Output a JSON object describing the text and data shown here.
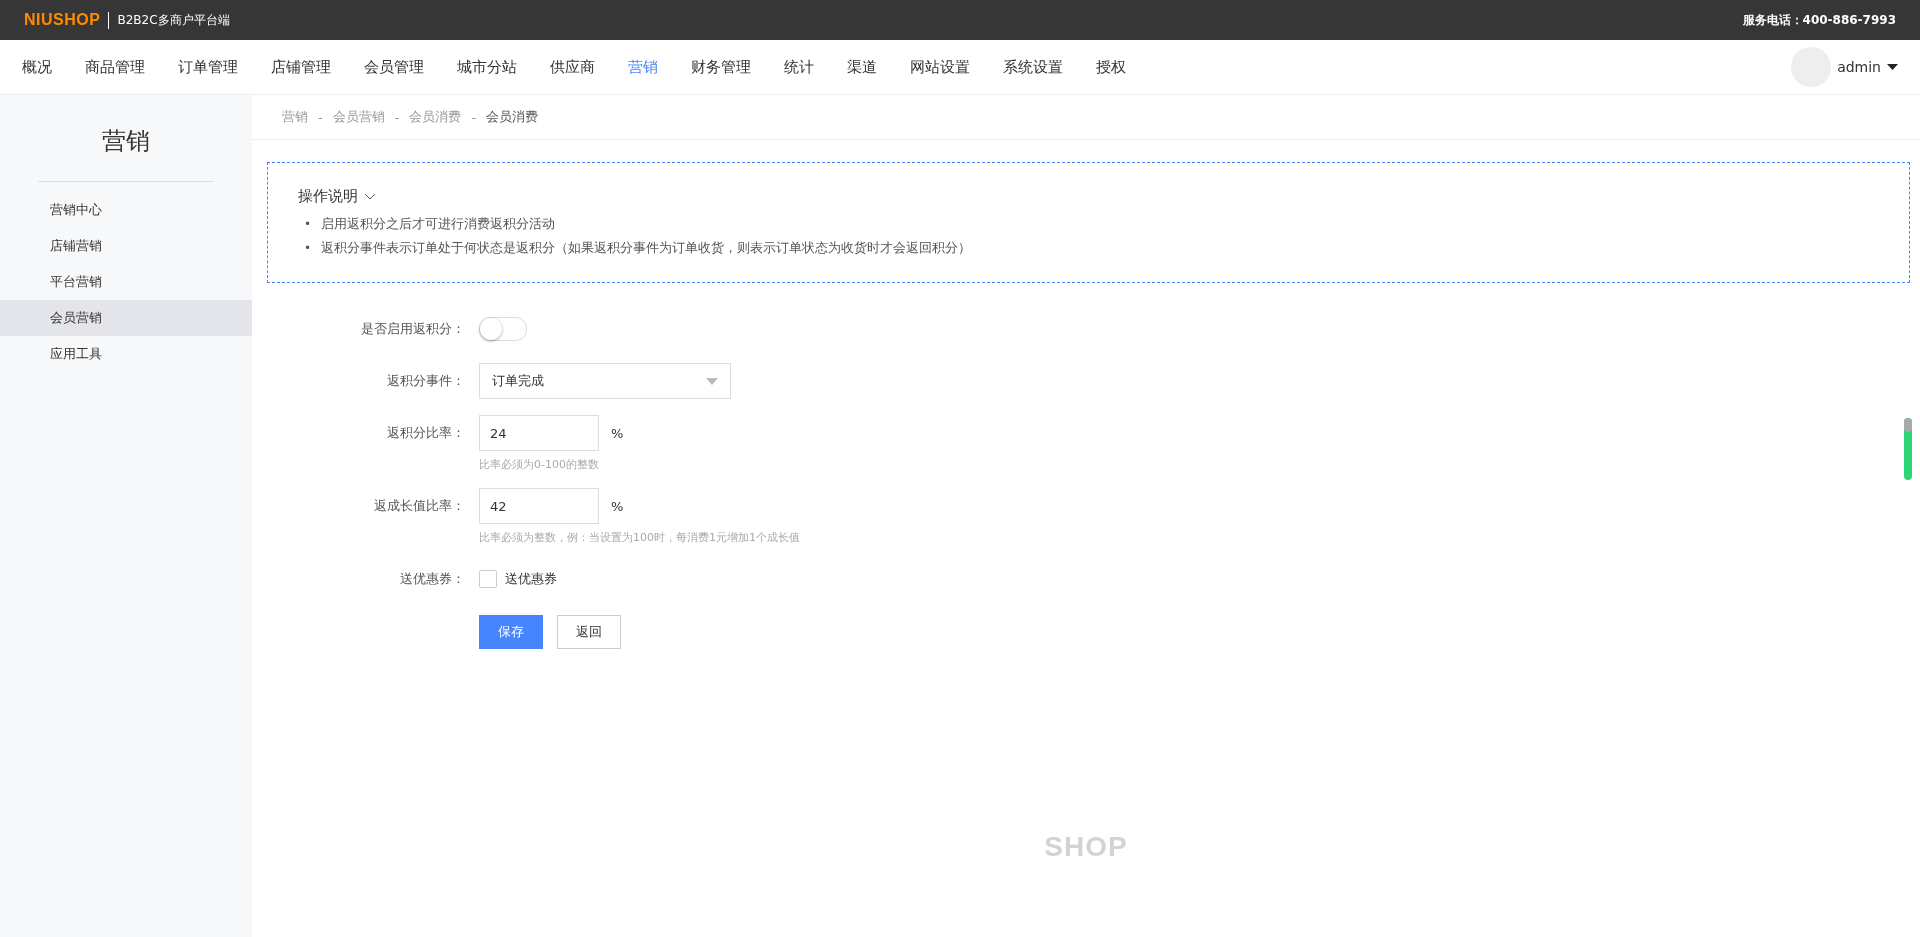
{
  "top_bar": {
    "logo": "NIUSHOP",
    "subtitle": "B2B2C多商户平台端",
    "service_phone": "服务电话：400-886-7993"
  },
  "nav": {
    "items": [
      {
        "label": "概况",
        "selected": false
      },
      {
        "label": "商品管理",
        "selected": false
      },
      {
        "label": "订单管理",
        "selected": false
      },
      {
        "label": "店铺管理",
        "selected": false
      },
      {
        "label": "会员管理",
        "selected": false
      },
      {
        "label": "城市分站",
        "selected": false
      },
      {
        "label": "供应商",
        "selected": false
      },
      {
        "label": "营销",
        "selected": true
      },
      {
        "label": "财务管理",
        "selected": false
      },
      {
        "label": "统计",
        "selected": false
      },
      {
        "label": "渠道",
        "selected": false
      },
      {
        "label": "网站设置",
        "selected": false
      },
      {
        "label": "系统设置",
        "selected": false
      },
      {
        "label": "授权",
        "selected": false
      }
    ],
    "user": "admin"
  },
  "sidebar": {
    "title": "营销",
    "items": [
      {
        "label": "营销中心",
        "selected": false
      },
      {
        "label": "店铺营销",
        "selected": false
      },
      {
        "label": "平台营销",
        "selected": false
      },
      {
        "label": "会员营销",
        "selected": true
      },
      {
        "label": "应用工具",
        "selected": false
      }
    ]
  },
  "breadcrumb": [
    {
      "label": "营销"
    },
    {
      "separator": "-",
      "label": "会员营销"
    },
    {
      "separator": "-",
      "label": "会员消费"
    },
    {
      "separator": "-",
      "label": "会员消费"
    }
  ],
  "notice": {
    "title": "操作说明",
    "items": [
      {
        "bullet": "•",
        "text": "启用返积分之后才可进行消费返积分活动"
      },
      {
        "bullet": "•",
        "text": "返积分事件表示订单处于何状态是返积分（如果返积分事件为订单收货，则表示订单状态为收货时才会返回积分）"
      }
    ]
  },
  "form": {
    "fields": [
      {
        "kind": "switch",
        "label": "是否启用返积分：",
        "on": false
      },
      {
        "kind": "select",
        "label": "返积分事件：",
        "value": "订单完成"
      },
      {
        "kind": "input",
        "label": "返积分比率：",
        "value": "24",
        "unit": "%",
        "hint": "比率必须为0-100的整数"
      },
      {
        "kind": "input",
        "label": "返成长值比率：",
        "value": "42",
        "unit": "%",
        "hint": "比率必须为整数，例：当设置为100时，每消费1元增加1个成长值"
      },
      {
        "kind": "checkbox",
        "label": "送优惠券：",
        "checked": false,
        "text": "送优惠券"
      }
    ],
    "buttons": [
      "保存",
      "返回"
    ]
  },
  "footer": {
    "logo": "SHOP"
  }
}
